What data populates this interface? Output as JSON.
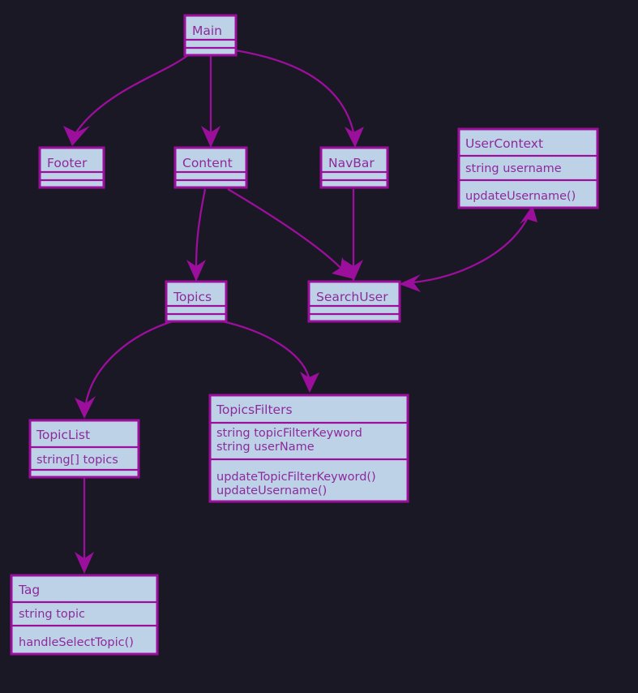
{
  "diagram": {
    "type": "uml-class-diagram",
    "background_color": "#1b1825",
    "box_fill_color": "#bed2e7",
    "box_border_color": "#9c0e9c",
    "text_color": "#8d2a9c",
    "edge_color": "#9c0e9c",
    "classes": [
      {
        "id": "main",
        "name": "Main",
        "attributes": [],
        "methods": []
      },
      {
        "id": "footer",
        "name": "Footer",
        "attributes": [],
        "methods": []
      },
      {
        "id": "content",
        "name": "Content",
        "attributes": [],
        "methods": []
      },
      {
        "id": "navbar",
        "name": "NavBar",
        "attributes": [],
        "methods": []
      },
      {
        "id": "usercontext",
        "name": "UserContext",
        "attributes": [
          "string username"
        ],
        "methods": [
          "updateUsername()"
        ]
      },
      {
        "id": "topics",
        "name": "Topics",
        "attributes": [],
        "methods": []
      },
      {
        "id": "searchuser",
        "name": "SearchUser",
        "attributes": [],
        "methods": []
      },
      {
        "id": "topicsfilters",
        "name": "TopicsFilters",
        "attributes": [
          "string topicFilterKeyword",
          "string userName"
        ],
        "methods": [
          "updateTopicFilterKeyword()",
          "updateUsername()"
        ]
      },
      {
        "id": "topiclist",
        "name": "TopicList",
        "attributes": [
          "string[] topics"
        ],
        "methods": []
      },
      {
        "id": "tag",
        "name": "Tag",
        "attributes": [
          "string topic"
        ],
        "methods": [
          "handleSelectTopic()"
        ]
      }
    ],
    "edges": [
      {
        "from": "main",
        "to": "footer",
        "arrow": "single"
      },
      {
        "from": "main",
        "to": "content",
        "arrow": "single"
      },
      {
        "from": "main",
        "to": "navbar",
        "arrow": "single"
      },
      {
        "from": "content",
        "to": "topics",
        "arrow": "single"
      },
      {
        "from": "content",
        "to": "searchuser",
        "arrow": "single"
      },
      {
        "from": "navbar",
        "to": "searchuser",
        "arrow": "single"
      },
      {
        "from": "searchuser",
        "to": "usercontext",
        "arrow": "double"
      },
      {
        "from": "topics",
        "to": "topiclist",
        "arrow": "single"
      },
      {
        "from": "topics",
        "to": "topicsfilters",
        "arrow": "single"
      },
      {
        "from": "topiclist",
        "to": "tag",
        "arrow": "single"
      }
    ]
  }
}
